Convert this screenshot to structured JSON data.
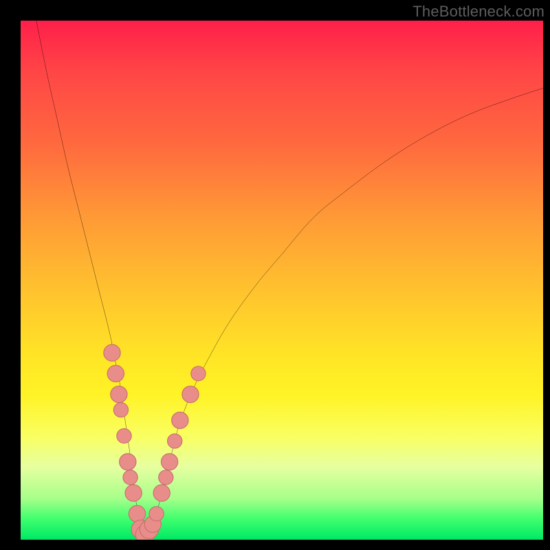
{
  "watermark": "TheBottleneck.com",
  "colors": {
    "curve": "#000000",
    "marker_fill": "#e88d8a",
    "marker_stroke": "#c86f6c",
    "gradient_top": "#ff1f4a",
    "gradient_bottom": "#00e865"
  },
  "chart_data": {
    "type": "line",
    "title": "",
    "xlabel": "",
    "ylabel": "",
    "xlim": [
      0,
      100
    ],
    "ylim": [
      0,
      100
    ],
    "grid": false,
    "legend": false,
    "note": "V-shaped bottleneck curve. x is relative performance ratio, y is bottleneck percentage. Minimum near x≈23. Marker points are sample hardware configurations clustered near the minimum.",
    "series": [
      {
        "name": "bottleneck-curve",
        "x": [
          3,
          5,
          7,
          9,
          11,
          13,
          15,
          17,
          18,
          19,
          20,
          21,
          22,
          23,
          24,
          25,
          26,
          27,
          28,
          29,
          30,
          31,
          33,
          36,
          40,
          45,
          50,
          56,
          62,
          70,
          78,
          86,
          94,
          100
        ],
        "values": [
          100,
          90,
          81,
          72,
          64,
          56,
          48,
          40,
          35,
          30,
          23,
          16,
          8,
          2,
          1,
          2,
          5,
          9,
          13,
          17,
          21,
          24,
          29,
          35,
          42,
          49,
          55,
          62,
          67,
          73,
          78,
          82,
          85,
          87
        ]
      }
    ],
    "markers": [
      {
        "x": 17.5,
        "y": 36,
        "r": 1.6
      },
      {
        "x": 18.2,
        "y": 32,
        "r": 1.6
      },
      {
        "x": 18.8,
        "y": 28,
        "r": 1.6
      },
      {
        "x": 19.2,
        "y": 25,
        "r": 1.4
      },
      {
        "x": 19.8,
        "y": 20,
        "r": 1.4
      },
      {
        "x": 20.5,
        "y": 15,
        "r": 1.6
      },
      {
        "x": 21.0,
        "y": 12,
        "r": 1.4
      },
      {
        "x": 21.6,
        "y": 9,
        "r": 1.6
      },
      {
        "x": 22.3,
        "y": 5,
        "r": 1.6
      },
      {
        "x": 23.0,
        "y": 2,
        "r": 1.8
      },
      {
        "x": 23.8,
        "y": 1,
        "r": 1.8
      },
      {
        "x": 24.6,
        "y": 2,
        "r": 1.8
      },
      {
        "x": 25.3,
        "y": 3,
        "r": 1.6
      },
      {
        "x": 26.0,
        "y": 5,
        "r": 1.4
      },
      {
        "x": 27.0,
        "y": 9,
        "r": 1.6
      },
      {
        "x": 27.8,
        "y": 12,
        "r": 1.4
      },
      {
        "x": 28.5,
        "y": 15,
        "r": 1.6
      },
      {
        "x": 29.5,
        "y": 19,
        "r": 1.4
      },
      {
        "x": 30.5,
        "y": 23,
        "r": 1.6
      },
      {
        "x": 32.5,
        "y": 28,
        "r": 1.6
      },
      {
        "x": 34.0,
        "y": 32,
        "r": 1.4
      }
    ]
  }
}
